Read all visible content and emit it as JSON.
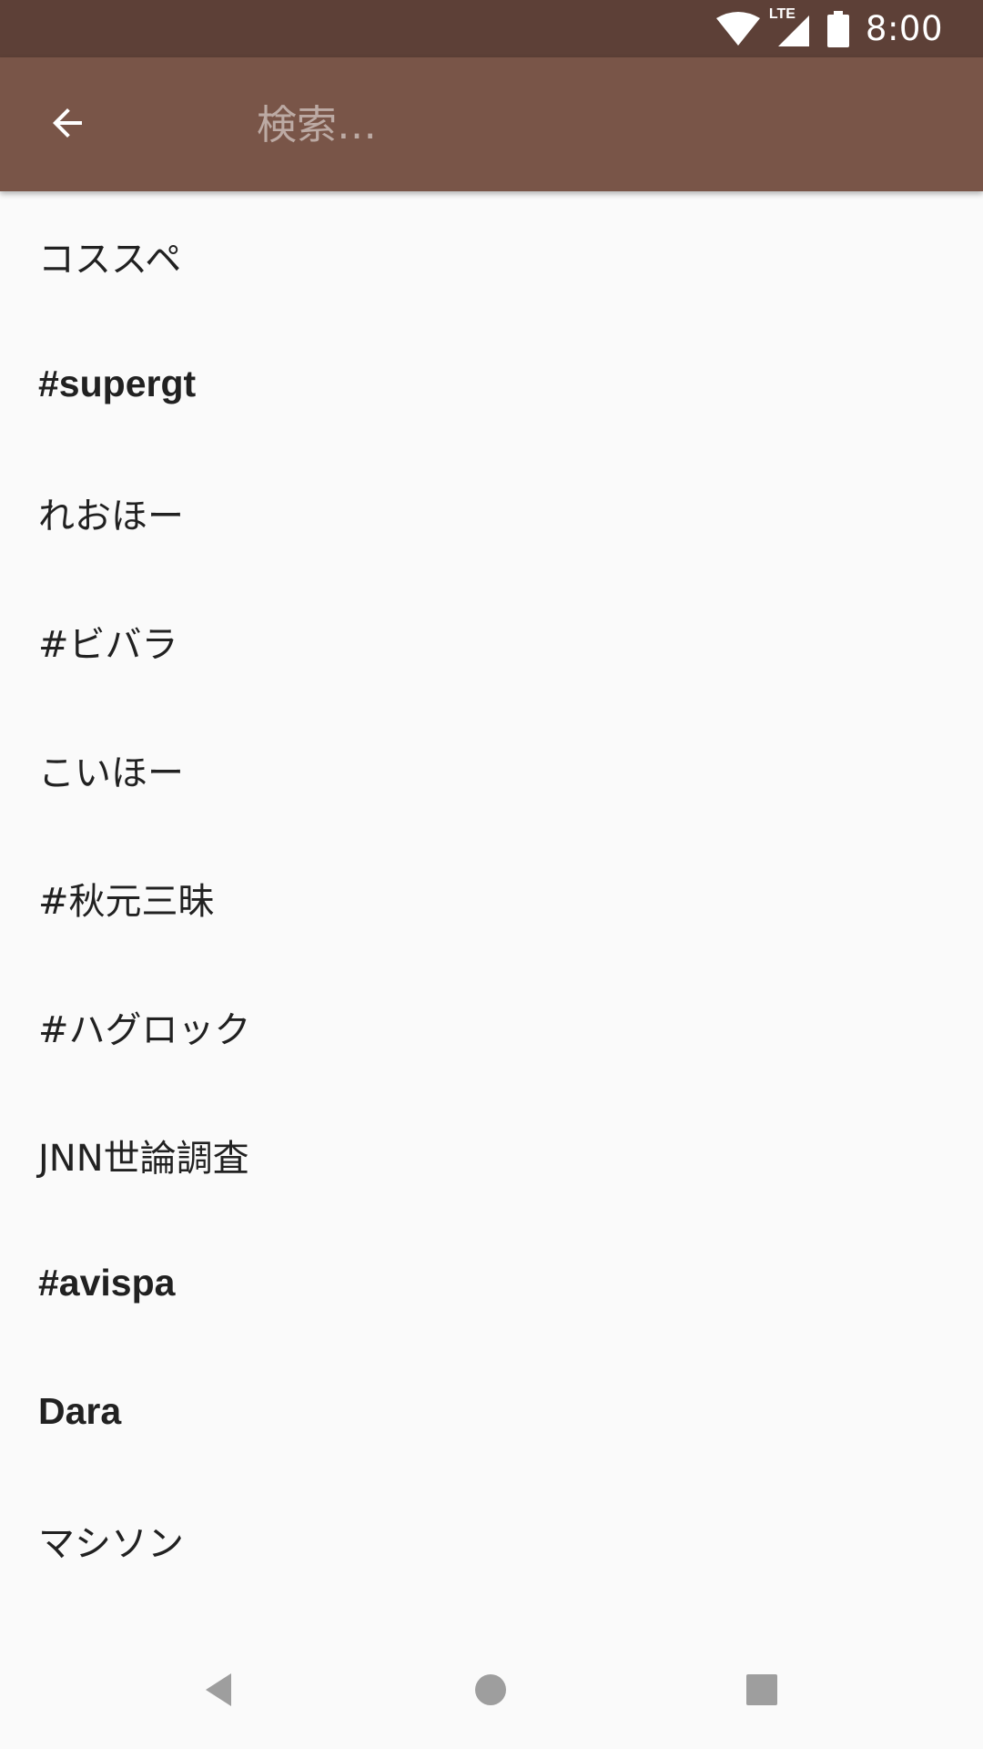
{
  "status_bar": {
    "network_label": "LTE",
    "time": "8:00",
    "background_color": "#5d4037",
    "icons": [
      "wifi-icon",
      "lte-signal-icon",
      "battery-icon"
    ]
  },
  "toolbar": {
    "background_color": "#795548",
    "back_icon": "arrow-left-icon",
    "search_placeholder": "検索…",
    "search_value": ""
  },
  "suggestions": [
    {
      "text": "コススペ",
      "bold": false
    },
    {
      "text": "#supergt",
      "bold": true
    },
    {
      "text": "れおほー",
      "bold": false
    },
    {
      "text": "#ビバラ",
      "bold": false
    },
    {
      "text": "こいほー",
      "bold": false
    },
    {
      "text": "#秋元三昧",
      "bold": false
    },
    {
      "text": "#ハグロック",
      "bold": false
    },
    {
      "text": "JNN世論調査",
      "bold": false
    },
    {
      "text": "#avispa",
      "bold": true
    },
    {
      "text": "Dara",
      "bold": true
    },
    {
      "text": "マシソン",
      "bold": false
    }
  ],
  "nav_bar": {
    "buttons": [
      "back-triangle-icon",
      "home-circle-icon",
      "recents-square-icon"
    ],
    "icon_color": "#9e9e9e"
  }
}
